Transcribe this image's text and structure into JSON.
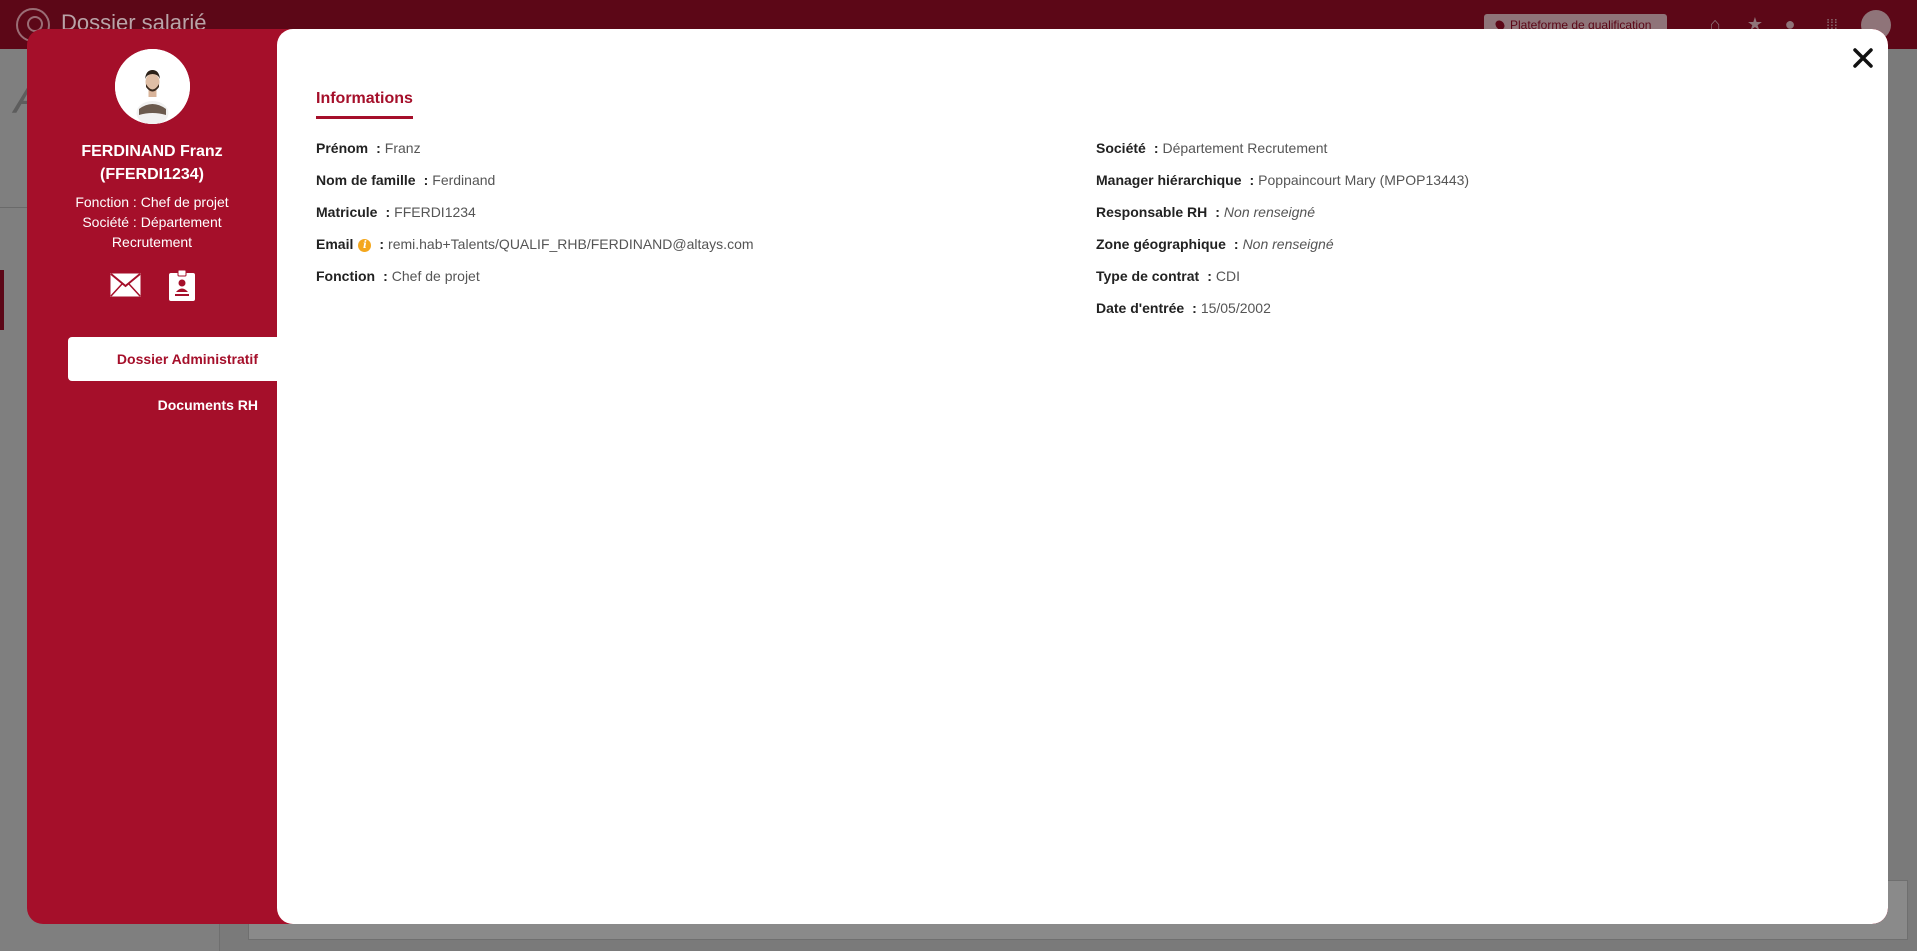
{
  "background": {
    "app_title": "Dossier salarié",
    "platform_label": "Plateforme de qualification"
  },
  "profile": {
    "name": "FERDINAND Franz",
    "id": "(FFERDI1234)",
    "fonction": "Fonction : Chef de projet",
    "societe": "Société : Département Recrutement"
  },
  "sidebar": {
    "items": [
      {
        "label": "Dossier Administratif"
      },
      {
        "label": "Documents RH"
      }
    ]
  },
  "tabs": {
    "informations": "Informations"
  },
  "fields_left": [
    {
      "label": "Prénom",
      "value": "Franz"
    },
    {
      "label": "Nom de famille",
      "value": "Ferdinand"
    },
    {
      "label": "Matricule",
      "value": "FFERDI1234"
    },
    {
      "label": "Email",
      "value": "remi.hab+Talents/QUALIF_RHB/FERDINAND@altays.com"
    },
    {
      "label": "Fonction",
      "value": "Chef de projet"
    }
  ],
  "fields_right": [
    {
      "label": "Société",
      "value": "Département Recrutement"
    },
    {
      "label": "Manager hiérarchique",
      "value": "Poppaincourt Mary (MPOP13443)"
    },
    {
      "label": "Responsable RH",
      "value": "Non renseigné"
    },
    {
      "label": "Zone géographique",
      "value": "Non renseigné"
    },
    {
      "label": "Type de contrat",
      "value": "CDI"
    },
    {
      "label": "Date d'entrée",
      "value": "15/05/2002"
    }
  ],
  "colors": {
    "brand": "#a50f2a",
    "topbar": "#5c0717",
    "overlay": "#7a7a7a"
  }
}
